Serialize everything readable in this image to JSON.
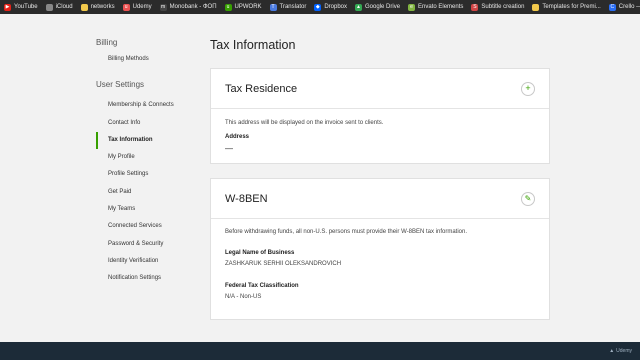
{
  "bookmarks": [
    {
      "label": "YouTube",
      "icon": "youtube-icon",
      "color": "#e62117",
      "glyph": "▶"
    },
    {
      "label": "iCloud",
      "icon": "apple-icon",
      "color": "#888888",
      "glyph": ""
    },
    {
      "label": "networks",
      "icon": "folder-icon",
      "color": "#f2c94c",
      "glyph": ""
    },
    {
      "label": "Udemy",
      "icon": "udemy-icon",
      "color": "#ec5252",
      "glyph": "u"
    },
    {
      "label": "Monobank - ФОП",
      "icon": "monobank-icon",
      "color": "#444444",
      "glyph": "m"
    },
    {
      "label": "UPWORK",
      "icon": "upwork-icon",
      "color": "#37a000",
      "glyph": "u"
    },
    {
      "label": "Translator",
      "icon": "translate-icon",
      "color": "#4a7ae0",
      "glyph": "T"
    },
    {
      "label": "Dropbox",
      "icon": "dropbox-icon",
      "color": "#0061fe",
      "glyph": "◆"
    },
    {
      "label": "Google Drive",
      "icon": "drive-icon",
      "color": "#34a853",
      "glyph": "▲"
    },
    {
      "label": "Envato Elements",
      "icon": "envato-icon",
      "color": "#82b541",
      "glyph": "e"
    },
    {
      "label": "Subtitle creation",
      "icon": "subtitle-icon",
      "color": "#d04545",
      "glyph": "S"
    },
    {
      "label": "Templates for Premi...",
      "icon": "folder-icon",
      "color": "#f2c94c",
      "glyph": ""
    },
    {
      "label": "Crello — Free Graph...",
      "icon": "crello-icon",
      "color": "#2a6df4",
      "glyph": "C"
    }
  ],
  "sidebar": {
    "billing_heading": "Billing",
    "billing_methods": "Billing Methods",
    "user_settings_heading": "User Settings",
    "items": [
      {
        "label": "Membership & Connects",
        "name": "sidebar-item-membership"
      },
      {
        "label": "Contact Info",
        "name": "sidebar-item-contact-info"
      },
      {
        "label": "Tax Information",
        "name": "sidebar-item-tax-information"
      },
      {
        "label": "My Profile",
        "name": "sidebar-item-my-profile"
      },
      {
        "label": "Profile Settings",
        "name": "sidebar-item-profile-settings"
      },
      {
        "label": "Get Paid",
        "name": "sidebar-item-get-paid"
      },
      {
        "label": "My Teams",
        "name": "sidebar-item-my-teams"
      },
      {
        "label": "Connected Services",
        "name": "sidebar-item-connected-services"
      },
      {
        "label": "Password & Security",
        "name": "sidebar-item-password-security"
      },
      {
        "label": "Identity Verification",
        "name": "sidebar-item-identity-verification"
      },
      {
        "label": "Notification Settings",
        "name": "sidebar-item-notification-settings"
      }
    ],
    "active_index": 2
  },
  "main": {
    "title": "Tax Information",
    "tax_residence": {
      "title": "Tax Residence",
      "description": "This address will be displayed on the invoice sent to clients.",
      "address_label": "Address",
      "address_value": "—",
      "add_glyph": "+"
    },
    "w8ben": {
      "title": "W-8BEN",
      "description": "Before withdrawing funds, all non-U.S. persons must provide their W-8BEN tax information.",
      "legal_name_label": "Legal Name of Business",
      "legal_name_value": "ZASHKARUK SERHII OLEKSANDROVICH",
      "federal_label": "Federal Tax Classification",
      "federal_value": "N/A - Non-US",
      "edit_glyph": "✎"
    }
  },
  "watermark": "Udemy",
  "colors": {
    "accent": "#37a000",
    "bottom_bar": "#1c2b38",
    "bookmarks_bar": "#2b2b2b"
  }
}
